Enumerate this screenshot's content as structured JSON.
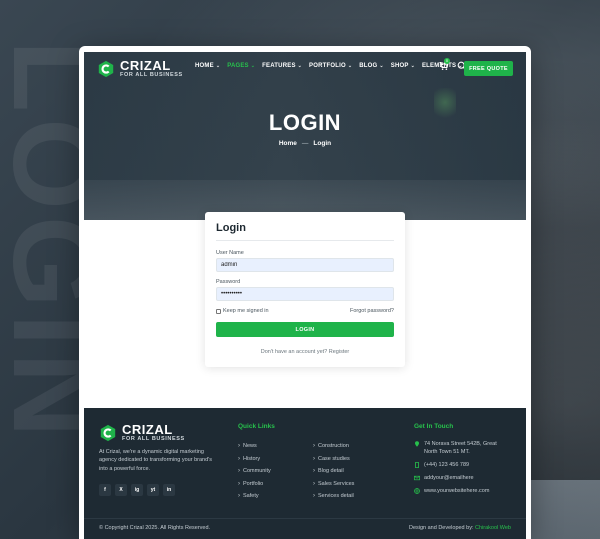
{
  "brand": {
    "name": "CRIZAL",
    "tagline": "FOR ALL BUSINESS",
    "accent": "#1fb34a"
  },
  "backdrop": {
    "word": "LOGIN"
  },
  "nav": {
    "items": [
      {
        "label": "HOME",
        "active": false
      },
      {
        "label": "PAGES",
        "active": true
      },
      {
        "label": "FEATURES",
        "active": false
      },
      {
        "label": "PORTFOLIO",
        "active": false
      },
      {
        "label": "BLOG",
        "active": false
      },
      {
        "label": "SHOP",
        "active": false
      },
      {
        "label": "ELEMENTS",
        "active": false
      }
    ],
    "cart_count": "0",
    "quote_label": "FREE QUOTE"
  },
  "hero": {
    "title": "LOGIN",
    "breadcrumb_home": "Home",
    "breadcrumb_sep": "—",
    "breadcrumb_current": "Login"
  },
  "login": {
    "title": "Login",
    "username_label": "User Name",
    "username_value": "admin",
    "password_label": "Password",
    "password_value": "••••••••••",
    "remember_label": "Keep me signed in",
    "forgot_label": "Forgot password?",
    "submit_label": "LOGIN",
    "register_prompt": "Don't have an account yet? Register"
  },
  "footer": {
    "description": "At Crizal, we're a dynamic digital marketing agency dedicated to transforming your brand's into a powerful force.",
    "socials": [
      "f",
      "X",
      "ig",
      "yt",
      "in"
    ],
    "quick_links_title": "Quick Links",
    "links_col1": [
      "News",
      "History",
      "Community",
      "Portfolio",
      "Safety"
    ],
    "links_col2": [
      "Construction",
      "Case studies",
      "Blog detail",
      "Sales Services",
      "Services detail"
    ],
    "contact_title": "Get In Touch",
    "contact": {
      "address": "74 Norava Street 542B, Great North Town 51 MT.",
      "phone": "(+44) 123 456 789",
      "email": "addyour@emailhere",
      "website": "www.yourwebsitehere.com"
    },
    "copyright": "© Copyright Crizal 2025. All Rights Reserved.",
    "credits_prefix": "Design and Developed by: ",
    "credits_brand": "Chirakool Web"
  }
}
